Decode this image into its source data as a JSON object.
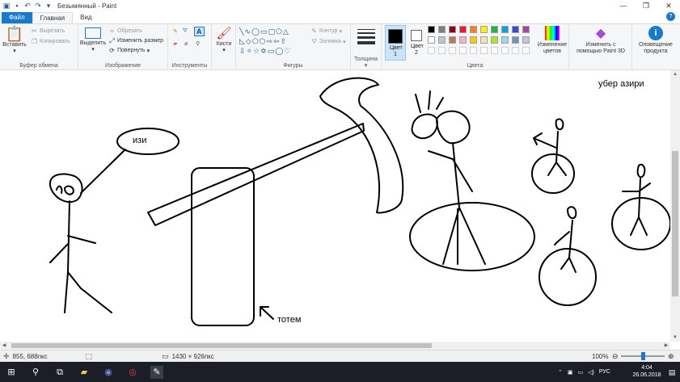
{
  "window": {
    "title": "Безымянный - Paint",
    "quick_access": [
      "save-icon",
      "undo-icon",
      "redo-icon",
      "customize-icon"
    ],
    "controls": [
      "minimize-icon",
      "restore-icon",
      "close-icon"
    ]
  },
  "tabs": [
    {
      "label": "Файл",
      "kind": "file"
    },
    {
      "label": "Главная",
      "kind": "active"
    },
    {
      "label": "Вид",
      "kind": "normal"
    }
  ],
  "ribbon": {
    "clipboard": {
      "label": "Буфер обмена",
      "paste": "Вставить",
      "cut": "Вырезать",
      "copy": "Копировать"
    },
    "image": {
      "label": "Изображение",
      "select": "Выделить",
      "crop": "Обрезать",
      "resize": "Изменить размер",
      "rotate": "Повернуть"
    },
    "tools": {
      "label": "Инструменты"
    },
    "brushes": {
      "label": "Кисти"
    },
    "shapes": {
      "label": "Фигуры",
      "outline": "Контур",
      "fill": "Заливка"
    },
    "size": {
      "label": "Толщина"
    },
    "colors": {
      "label": "Цвета",
      "color1_label": "Цвет 1",
      "color2_label": "Цвет 2",
      "color1": "#000000",
      "color2": "#ffffff",
      "edit_colors": "Изменение цветов",
      "palette": [
        "#000000",
        "#7f7f7f",
        "#880015",
        "#ed1c24",
        "#ff7f27",
        "#fff200",
        "#22b14c",
        "#00a2e8",
        "#3f48cc",
        "#a349a4",
        "#ffffff",
        "#c3c3c3",
        "#b97a57",
        "#ffaec9",
        "#ffc90e",
        "#efe4b0",
        "#b5e61d",
        "#99d9ea",
        "#7092be",
        "#c8bfe7"
      ]
    },
    "paint3d": "Изменить с помощью Paint 3D",
    "product_alert": "Оповещение продукта"
  },
  "canvas": {
    "labels": {
      "izi": "изи",
      "totem": "тотем",
      "uber": "убер азири"
    }
  },
  "status": {
    "cursor_pos": "855, 688пкс",
    "image_size": "1430 × 926пкс",
    "zoom": "100%",
    "zoom_level": 0.5
  },
  "taskbar": {
    "lang": "РУС",
    "time": "4:04",
    "date": "26.06.2018"
  }
}
